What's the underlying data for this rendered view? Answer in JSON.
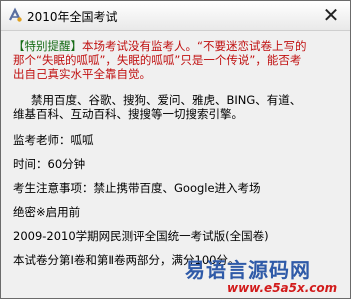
{
  "window": {
    "title": "2010年全国考试",
    "close_symbol": "✕"
  },
  "notice": {
    "tag": "【特别提醒】",
    "line1_rest": "本场考试没有监考人。“不要迷恋试卷上写的",
    "line2": "那个“失眠的呱呱”，失眠的呱呱”只是一个传说”，能否考",
    "line3": "出自己真实水平全靠自觉。"
  },
  "banned": {
    "line1": "禁用百度、谷歌、搜狗、爱问、雅虎、BING、有道、",
    "line2": "维基百科、互动百科、搜搜等一切搜索引擎。"
  },
  "proctor": "监考老师：呱呱",
  "time": "时间：60分钟",
  "notes": "考生注意事项：禁止携带百度、Google进入考场",
  "secret": "绝密※启用前",
  "exam_name": "2009-2010学期网民测评全国统一考试版(全国卷)",
  "exam_parts": "本试卷分第Ⅰ卷和第Ⅱ卷两部分，满分100分。",
  "watermark": {
    "main": "易语言源码网",
    "url": "www.e5a5x.com"
  }
}
